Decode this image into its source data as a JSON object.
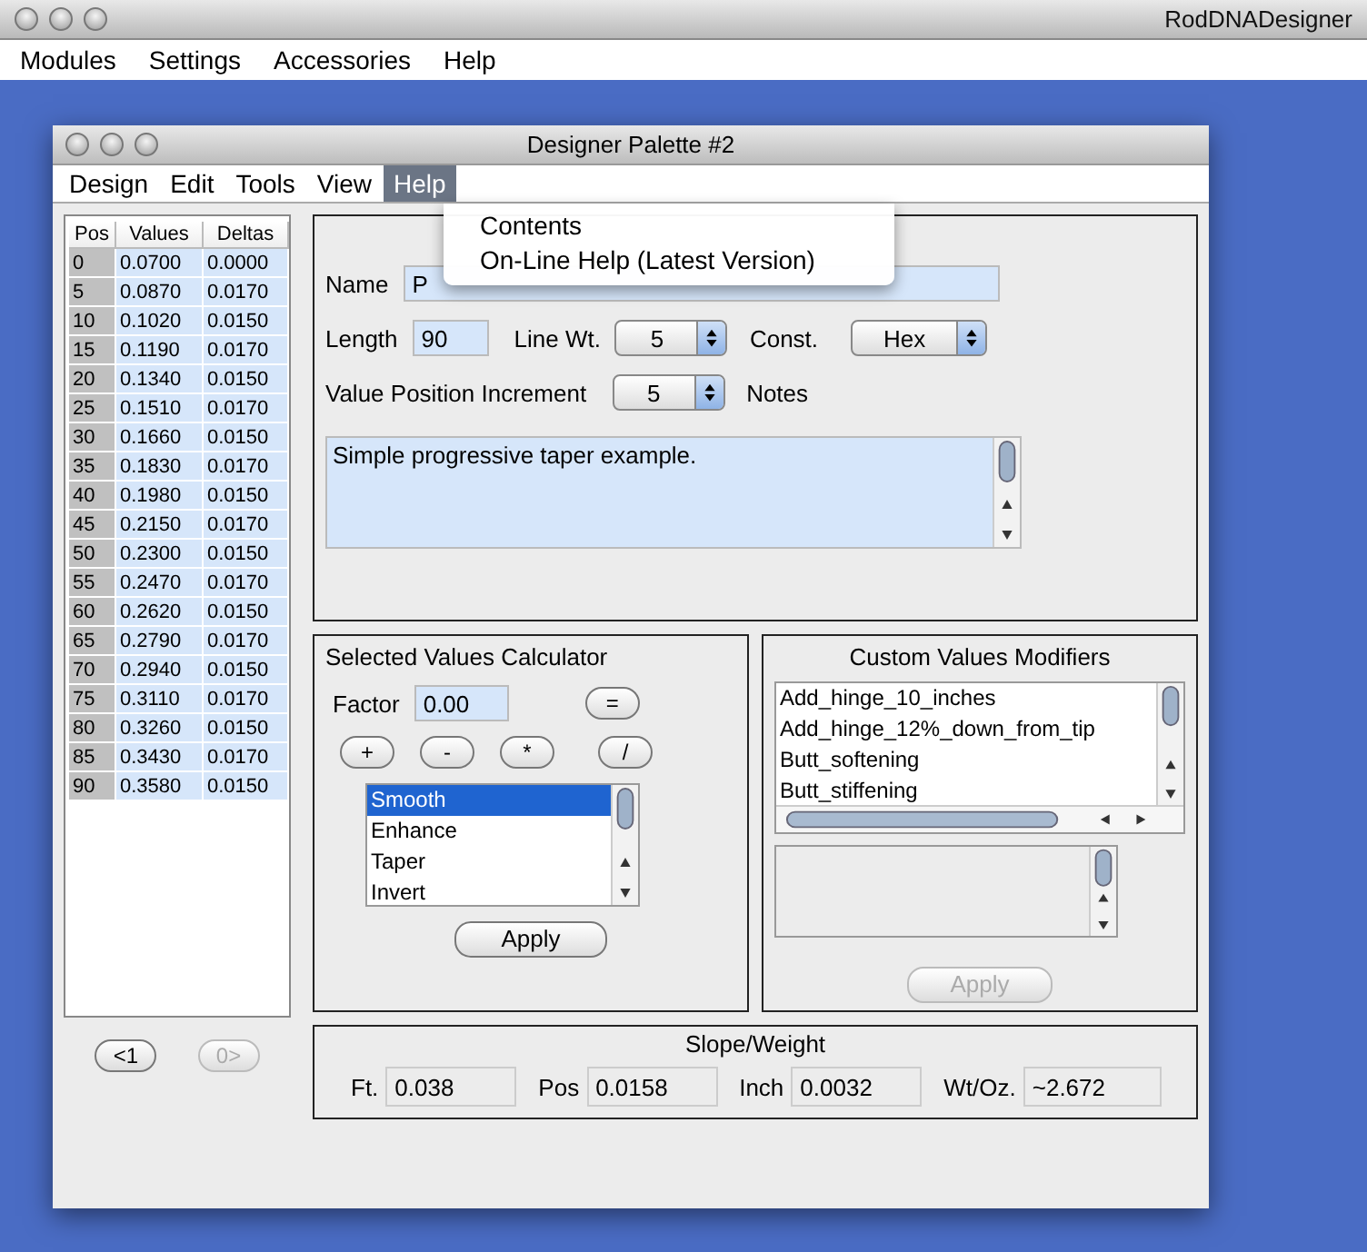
{
  "app": {
    "title": "RodDNADesigner",
    "menu": [
      "Modules",
      "Settings",
      "Accessories",
      "Help"
    ]
  },
  "palette": {
    "title": "Designer Palette #2",
    "menu": [
      {
        "label": "Design",
        "selected": false
      },
      {
        "label": "Edit",
        "selected": false
      },
      {
        "label": "Tools",
        "selected": false
      },
      {
        "label": "View",
        "selected": false
      },
      {
        "label": "Help",
        "selected": true
      }
    ],
    "help_menu": [
      "Contents",
      "On-Line Help (Latest Version)"
    ]
  },
  "table": {
    "columns": [
      "Pos",
      "Values",
      "Deltas"
    ],
    "rows": [
      [
        "0",
        "0.0700",
        "0.0000"
      ],
      [
        "5",
        "0.0870",
        "0.0170"
      ],
      [
        "10",
        "0.1020",
        "0.0150"
      ],
      [
        "15",
        "0.1190",
        "0.0170"
      ],
      [
        "20",
        "0.1340",
        "0.0150"
      ],
      [
        "25",
        "0.1510",
        "0.0170"
      ],
      [
        "30",
        "0.1660",
        "0.0150"
      ],
      [
        "35",
        "0.1830",
        "0.0170"
      ],
      [
        "40",
        "0.1980",
        "0.0150"
      ],
      [
        "45",
        "0.2150",
        "0.0170"
      ],
      [
        "50",
        "0.2300",
        "0.0150"
      ],
      [
        "55",
        "0.2470",
        "0.0170"
      ],
      [
        "60",
        "0.2620",
        "0.0150"
      ],
      [
        "65",
        "0.2790",
        "0.0170"
      ],
      [
        "70",
        "0.2940",
        "0.0150"
      ],
      [
        "75",
        "0.3110",
        "0.0170"
      ],
      [
        "80",
        "0.3260",
        "0.0150"
      ],
      [
        "85",
        "0.3430",
        "0.0170"
      ],
      [
        "90",
        "0.3580",
        "0.0150"
      ]
    ]
  },
  "nav_buttons": [
    {
      "label": "<1",
      "disabled": false
    },
    {
      "label": "0>",
      "disabled": true
    }
  ],
  "design_properties": {
    "name_label": "Name",
    "name_value": "P",
    "length_label": "Length",
    "length_value": "90",
    "line_wt_label": "Line Wt.",
    "line_wt_value": "5",
    "const_label": "Const.",
    "const_value": "Hex",
    "increment_label": "Value Position Increment",
    "increment_value": "5",
    "notes_label": "Notes",
    "notes_value": "Simple progressive taper example."
  },
  "calculator": {
    "title": "Selected Values Calculator",
    "factor_label": "Factor",
    "factor_value": "0.00",
    "equals_button": "=",
    "operator_buttons": [
      "+",
      "-",
      "*",
      "/"
    ],
    "list": [
      {
        "label": "Smooth",
        "selected": true
      },
      {
        "label": "Enhance",
        "selected": false
      },
      {
        "label": "Taper",
        "selected": false
      },
      {
        "label": "Invert",
        "selected": false
      }
    ],
    "apply": {
      "label": "Apply",
      "disabled": false
    }
  },
  "modifiers": {
    "title": "Custom Values Modifiers",
    "list": [
      "Add_hinge_10_inches",
      "Add_hinge_12%_down_from_tip",
      "Butt_softening",
      "Butt_stiffening"
    ],
    "apply": {
      "label": "Apply",
      "disabled": true
    }
  },
  "slope": {
    "title": "Slope/Weight",
    "fields": [
      {
        "label": "Ft.",
        "value": "0.038"
      },
      {
        "label": "Pos",
        "value": "0.0158"
      },
      {
        "label": "Inch",
        "value": "0.0032"
      },
      {
        "label": "Wt/Oz.",
        "value": "~2.672"
      }
    ]
  }
}
